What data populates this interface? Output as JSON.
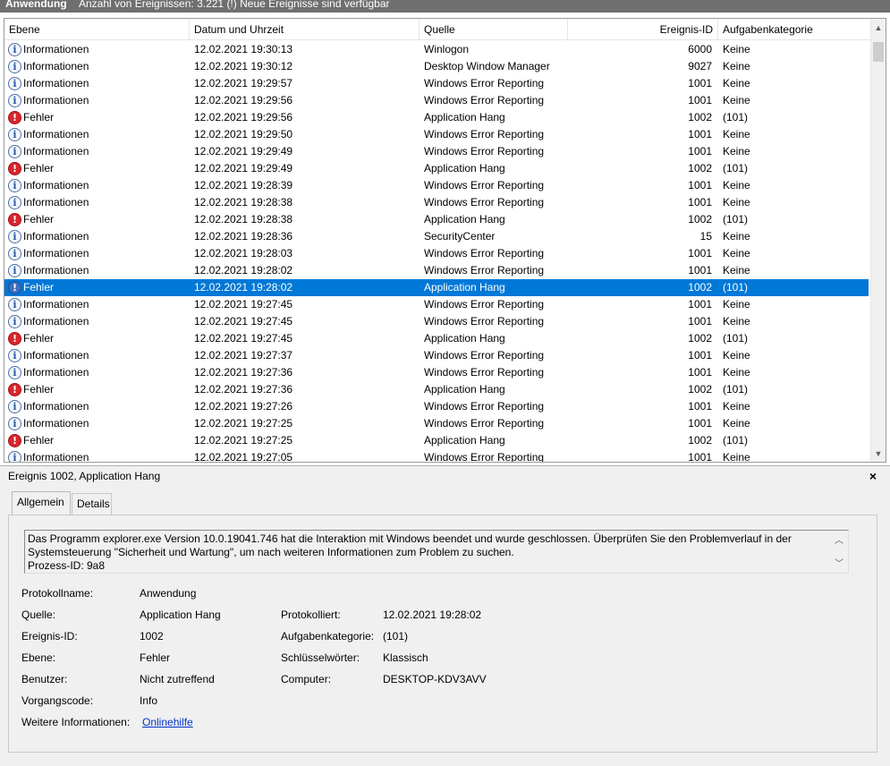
{
  "topbar": {
    "title": "Anwendung",
    "subtitle": "Anzahl von Ereignissen: 3.221 (!) Neue Ereignisse sind verfügbar"
  },
  "columns": {
    "level": "Ebene",
    "date": "Datum und Uhrzeit",
    "source": "Quelle",
    "id": "Ereignis-ID",
    "category": "Aufgabenkategorie"
  },
  "icons": {
    "info": "info-icon",
    "error": "error-icon"
  },
  "rows": [
    {
      "type": "info",
      "level": "Informationen",
      "date": "12.02.2021 19:30:13",
      "source": "Winlogon",
      "id": "6000",
      "category": "Keine"
    },
    {
      "type": "info",
      "level": "Informationen",
      "date": "12.02.2021 19:30:12",
      "source": "Desktop Window Manager",
      "id": "9027",
      "category": "Keine"
    },
    {
      "type": "info",
      "level": "Informationen",
      "date": "12.02.2021 19:29:57",
      "source": "Windows Error Reporting",
      "id": "1001",
      "category": "Keine"
    },
    {
      "type": "info",
      "level": "Informationen",
      "date": "12.02.2021 19:29:56",
      "source": "Windows Error Reporting",
      "id": "1001",
      "category": "Keine"
    },
    {
      "type": "error",
      "level": "Fehler",
      "date": "12.02.2021 19:29:56",
      "source": "Application Hang",
      "id": "1002",
      "category": "(101)"
    },
    {
      "type": "info",
      "level": "Informationen",
      "date": "12.02.2021 19:29:50",
      "source": "Windows Error Reporting",
      "id": "1001",
      "category": "Keine"
    },
    {
      "type": "info",
      "level": "Informationen",
      "date": "12.02.2021 19:29:49",
      "source": "Windows Error Reporting",
      "id": "1001",
      "category": "Keine"
    },
    {
      "type": "error",
      "level": "Fehler",
      "date": "12.02.2021 19:29:49",
      "source": "Application Hang",
      "id": "1002",
      "category": "(101)"
    },
    {
      "type": "info",
      "level": "Informationen",
      "date": "12.02.2021 19:28:39",
      "source": "Windows Error Reporting",
      "id": "1001",
      "category": "Keine"
    },
    {
      "type": "info",
      "level": "Informationen",
      "date": "12.02.2021 19:28:38",
      "source": "Windows Error Reporting",
      "id": "1001",
      "category": "Keine"
    },
    {
      "type": "error",
      "level": "Fehler",
      "date": "12.02.2021 19:28:38",
      "source": "Application Hang",
      "id": "1002",
      "category": "(101)"
    },
    {
      "type": "info",
      "level": "Informationen",
      "date": "12.02.2021 19:28:36",
      "source": "SecurityCenter",
      "id": "15",
      "category": "Keine"
    },
    {
      "type": "info",
      "level": "Informationen",
      "date": "12.02.2021 19:28:03",
      "source": "Windows Error Reporting",
      "id": "1001",
      "category": "Keine"
    },
    {
      "type": "info",
      "level": "Informationen",
      "date": "12.02.2021 19:28:02",
      "source": "Windows Error Reporting",
      "id": "1001",
      "category": "Keine"
    },
    {
      "type": "error",
      "level": "Fehler",
      "date": "12.02.2021 19:28:02",
      "source": "Application Hang",
      "id": "1002",
      "category": "(101)",
      "selected": true
    },
    {
      "type": "info",
      "level": "Informationen",
      "date": "12.02.2021 19:27:45",
      "source": "Windows Error Reporting",
      "id": "1001",
      "category": "Keine"
    },
    {
      "type": "info",
      "level": "Informationen",
      "date": "12.02.2021 19:27:45",
      "source": "Windows Error Reporting",
      "id": "1001",
      "category": "Keine"
    },
    {
      "type": "error",
      "level": "Fehler",
      "date": "12.02.2021 19:27:45",
      "source": "Application Hang",
      "id": "1002",
      "category": "(101)"
    },
    {
      "type": "info",
      "level": "Informationen",
      "date": "12.02.2021 19:27:37",
      "source": "Windows Error Reporting",
      "id": "1001",
      "category": "Keine"
    },
    {
      "type": "info",
      "level": "Informationen",
      "date": "12.02.2021 19:27:36",
      "source": "Windows Error Reporting",
      "id": "1001",
      "category": "Keine"
    },
    {
      "type": "error",
      "level": "Fehler",
      "date": "12.02.2021 19:27:36",
      "source": "Application Hang",
      "id": "1002",
      "category": "(101)"
    },
    {
      "type": "info",
      "level": "Informationen",
      "date": "12.02.2021 19:27:26",
      "source": "Windows Error Reporting",
      "id": "1001",
      "category": "Keine"
    },
    {
      "type": "info",
      "level": "Informationen",
      "date": "12.02.2021 19:27:25",
      "source": "Windows Error Reporting",
      "id": "1001",
      "category": "Keine"
    },
    {
      "type": "error",
      "level": "Fehler",
      "date": "12.02.2021 19:27:25",
      "source": "Application Hang",
      "id": "1002",
      "category": "(101)"
    },
    {
      "type": "info",
      "level": "Informationen",
      "date": "12.02.2021 19:27:05",
      "source": "Windows Error Reporting",
      "id": "1001",
      "category": "Keine"
    }
  ],
  "detail": {
    "title": "Ereignis 1002, Application Hang",
    "close": "×",
    "tab_general": "Allgemein",
    "tab_details": "Details",
    "description": "Das Programm explorer.exe Version 10.0.19041.746 hat die Interaktion mit Windows beendet und wurde geschlossen. Überprüfen Sie den Problemverlauf in der\nSystemsteuerung \"Sicherheit und Wartung\", um nach weiteren Informationen zum Problem zu suchen.\n Prozess-ID: 9a8",
    "labels": {
      "log_name": "Protokollname:",
      "source": "Quelle:",
      "event_id": "Ereignis-ID:",
      "level": "Ebene:",
      "user": "Benutzer:",
      "opcode": "Vorgangscode:",
      "more_info": "Weitere Informationen:",
      "logged": "Protokolliert:",
      "task_category": "Aufgabenkategorie:",
      "keywords": "Schlüsselwörter:",
      "computer": "Computer:"
    },
    "values": {
      "log_name": "Anwendung",
      "source": "Application Hang",
      "event_id": "1002",
      "level": "Fehler",
      "user": "Nicht zutreffend",
      "opcode": "Info",
      "more_info": "Onlinehilfe",
      "logged": "12.02.2021 19:28:02",
      "task_category": "(101)",
      "keywords": "Klassisch",
      "computer": "DESKTOP-KDV3AVV"
    }
  },
  "colors": {
    "selection": "#0078d7",
    "error_icon": "#d8262c",
    "info_icon": "#2a58a8",
    "link": "#0033cc"
  }
}
